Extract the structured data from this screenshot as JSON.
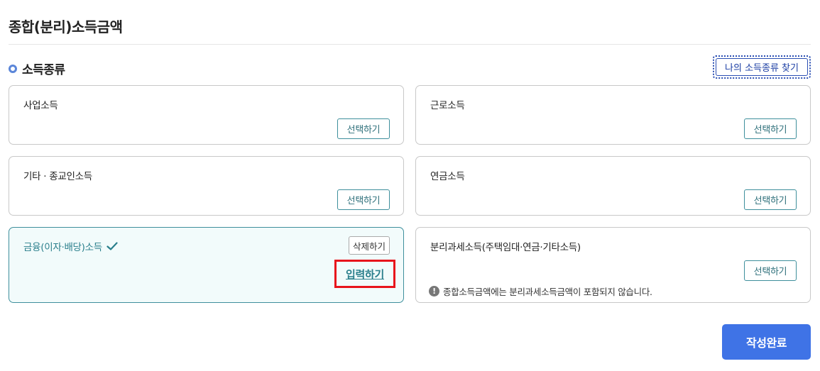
{
  "page": {
    "title": "종합(분리)소득금액"
  },
  "section": {
    "title": "소득종류",
    "find_button": "나의 소득종류 찾기"
  },
  "cards": [
    {
      "title": "사업소득",
      "select_label": "선택하기"
    },
    {
      "title": "근로소득",
      "select_label": "선택하기"
    },
    {
      "title": "기타 · 종교인소득",
      "select_label": "선택하기"
    },
    {
      "title": "연금소득",
      "select_label": "선택하기"
    },
    {
      "title": "금융(이자·배당)소득",
      "delete_label": "삭제하기",
      "input_label": "입력하기",
      "selected": true
    },
    {
      "title": "분리과세소득(주택임대·연금·기타소득)",
      "select_label": "선택하기",
      "notice": "종합소득금액에는 분리과세소득금액이 포함되지 않습니다."
    }
  ],
  "footer": {
    "submit_label": "작성완료"
  },
  "colors": {
    "accent": "#3f73e6",
    "teal": "#2a7f8c",
    "highlight": "#e8141c"
  },
  "icons": [
    "bullet-icon",
    "check-icon",
    "info-icon"
  ]
}
